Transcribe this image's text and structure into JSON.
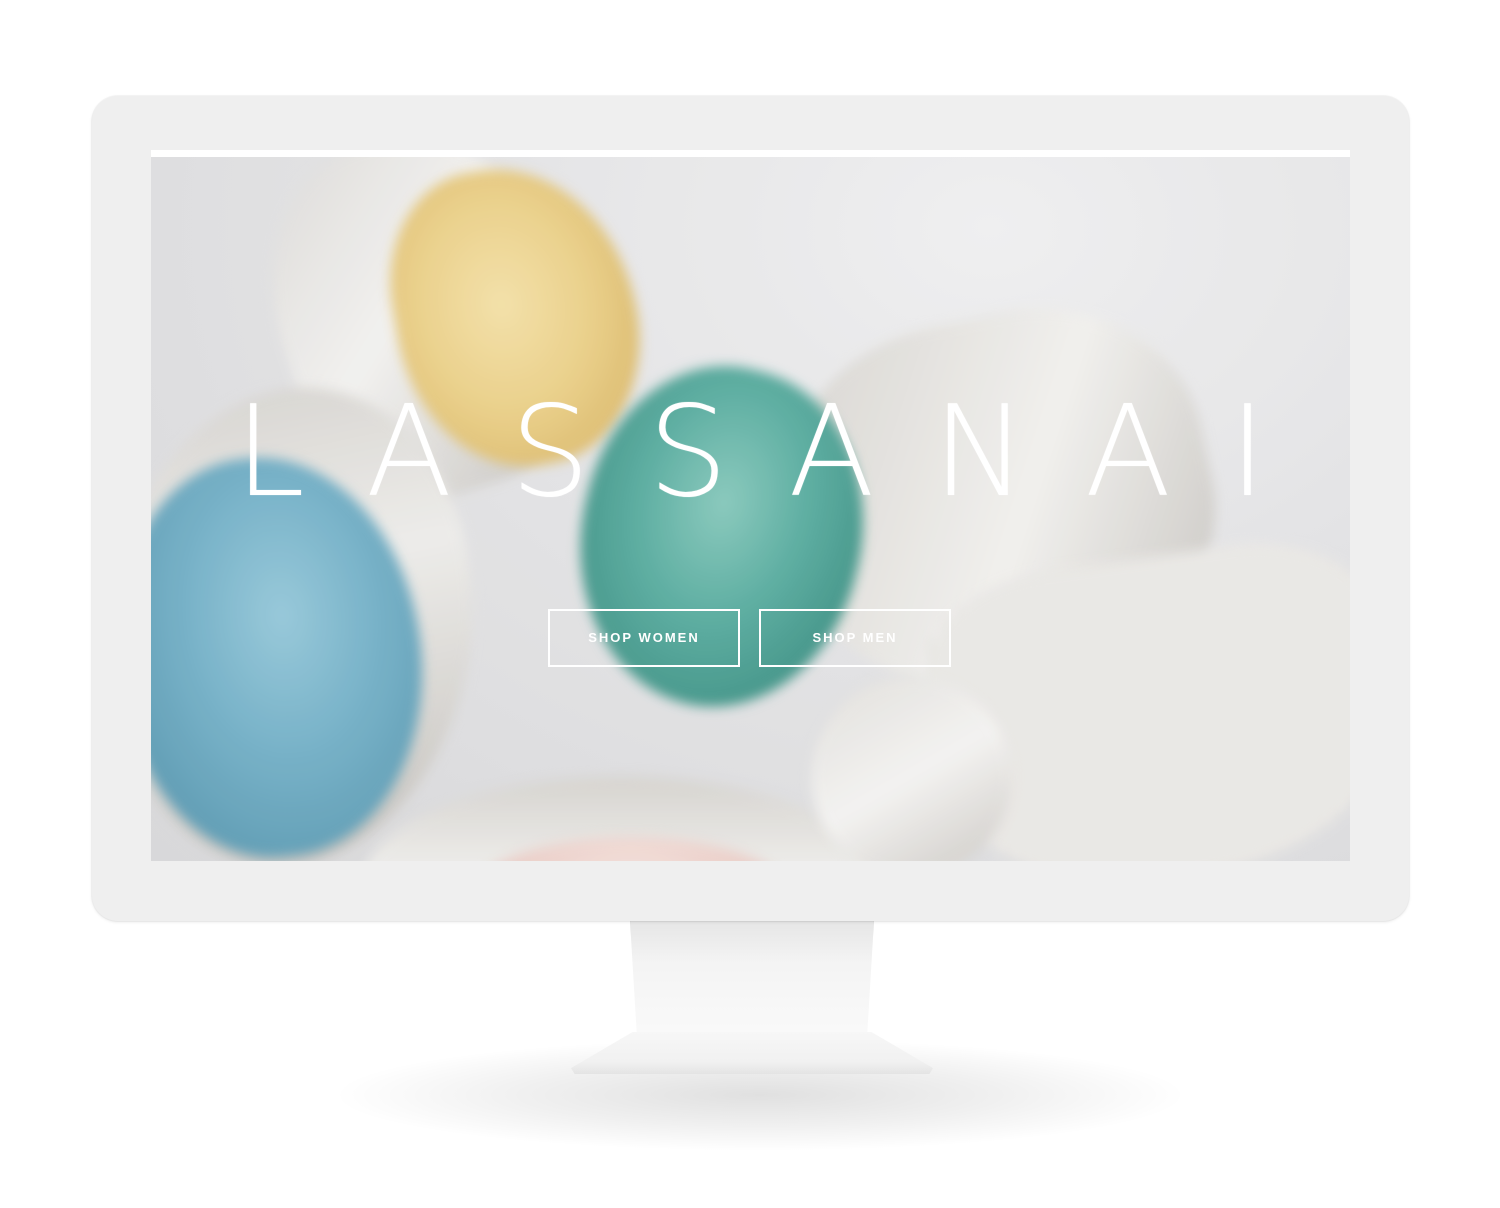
{
  "site": {
    "brand_name": "LASSANAI"
  },
  "hero": {
    "background_image": "blurred-gemstone-rings-photo",
    "buttons": [
      {
        "label": "SHOP WOMEN"
      },
      {
        "label": "SHOP MEN"
      }
    ]
  },
  "device": {
    "type": "desktop-monitor-mockup",
    "bezel_color": "#efefef",
    "screen_top_strip_color": "#ffffff"
  },
  "colors": {
    "text": "#ffffff",
    "gem_yellow": "#e9cc7e",
    "gem_green": "#4aa597",
    "gem_blue": "#67a9c2",
    "gem_pink": "#e8c7c0",
    "silver": "#e2e0dc"
  }
}
